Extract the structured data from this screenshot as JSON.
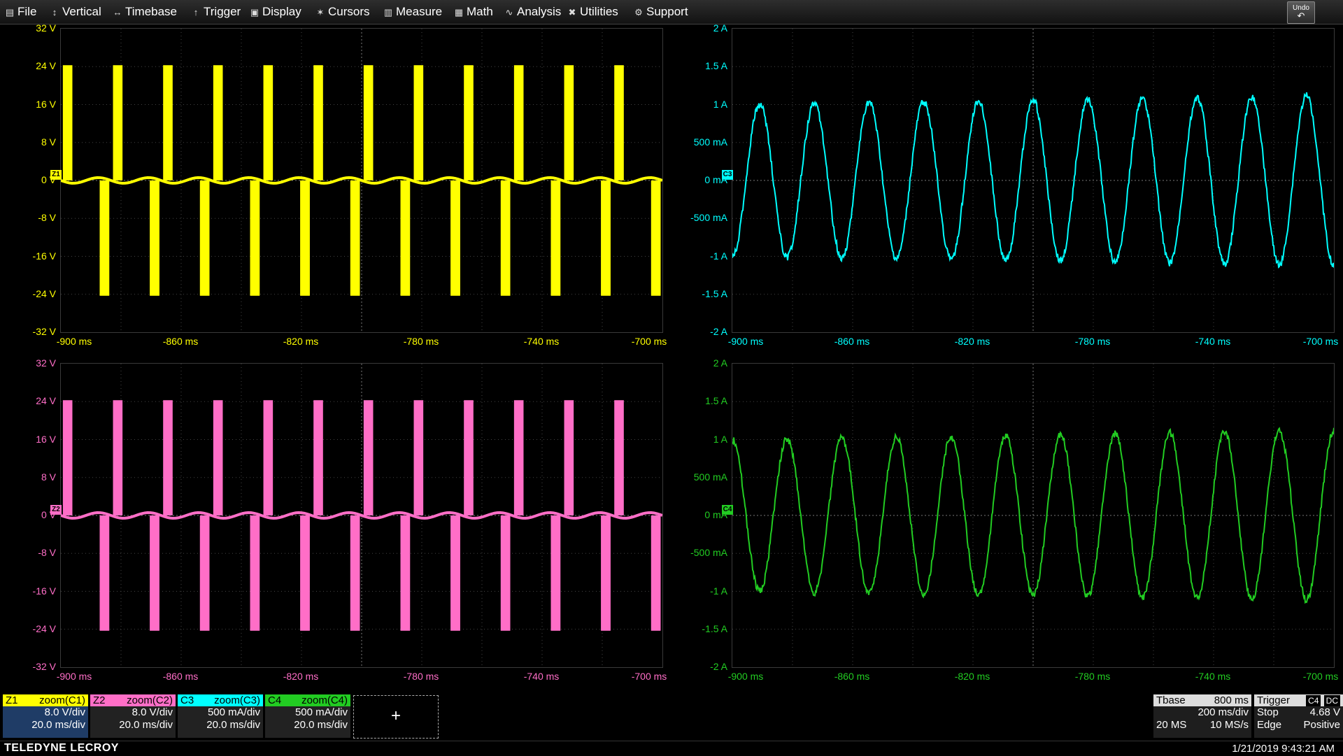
{
  "menu": [
    {
      "label": "File",
      "icon": "file-icon"
    },
    {
      "label": "Vertical",
      "icon": "vertical-icon"
    },
    {
      "label": "Timebase",
      "icon": "timebase-icon"
    },
    {
      "label": "Trigger",
      "icon": "trigger-icon"
    },
    {
      "label": "Display",
      "icon": "display-icon"
    },
    {
      "label": "Cursors",
      "icon": "cursors-icon"
    },
    {
      "label": "Measure",
      "icon": "measure-icon"
    },
    {
      "label": "Math",
      "icon": "math-icon"
    },
    {
      "label": "Analysis",
      "icon": "analysis-icon"
    },
    {
      "label": "Utilities",
      "icon": "utilities-icon"
    },
    {
      "label": "Support",
      "icon": "support-icon"
    }
  ],
  "undo_label": "Undo",
  "plots": [
    {
      "id": "Z1",
      "color": "#ffff00",
      "marker": "Z1",
      "kind": "pwm",
      "y_labels": [
        "32 V",
        "24 V",
        "16 V",
        "8 V",
        "0 V",
        "-8 V",
        "-16 V",
        "-24 V",
        "-32 V"
      ],
      "x_labels": [
        "-900 ms",
        "-860 ms",
        "-820 ms",
        "-780 ms",
        "-740 ms",
        "-700 ms"
      ]
    },
    {
      "id": "C3",
      "color": "#00ffff",
      "marker": "C3",
      "kind": "sine",
      "y_labels": [
        "2 A",
        "1.5 A",
        "1 A",
        "500 mA",
        "0 mA",
        "-500 mA",
        "-1 A",
        "-1.5 A",
        "-2 A"
      ],
      "x_labels": [
        "-900 ms",
        "-860 ms",
        "-820 ms",
        "-780 ms",
        "-740 ms",
        "-700 ms"
      ]
    },
    {
      "id": "Z2",
      "color": "#ff6ec7",
      "marker": "Z2",
      "kind": "pwm",
      "y_labels": [
        "32 V",
        "24 V",
        "16 V",
        "8 V",
        "0 V",
        "-8 V",
        "-16 V",
        "-24 V",
        "-32 V"
      ],
      "x_labels": [
        "-900 ms",
        "-860 ms",
        "-820 ms",
        "-780 ms",
        "-740 ms",
        "-700 ms"
      ]
    },
    {
      "id": "C4",
      "color": "#22cc22",
      "marker": "C4",
      "kind": "sine",
      "y_labels": [
        "2 A",
        "1.5 A",
        "1 A",
        "500 mA",
        "0 mA",
        "-500 mA",
        "-1 A",
        "-1.5 A",
        "-2 A"
      ],
      "x_labels": [
        "-900 ms",
        "-860 ms",
        "-820 ms",
        "-780 ms",
        "-740 ms",
        "-700 ms"
      ]
    }
  ],
  "descriptors": [
    {
      "tag": "Z1",
      "source": "zoom(C1)",
      "vdiv": "8.0 V/div",
      "tdiv": "20.0 ms/div",
      "color": "#ffff00",
      "body": "#1f3c66"
    },
    {
      "tag": "Z2",
      "source": "zoom(C2)",
      "vdiv": "8.0 V/div",
      "tdiv": "20.0 ms/div",
      "color": "#ff6ec7",
      "body": "#222222"
    },
    {
      "tag": "C3",
      "source": "zoom(C3)",
      "vdiv": "500 mA/div",
      "tdiv": "20.0 ms/div",
      "color": "#00ffff",
      "body": "#222222"
    },
    {
      "tag": "C4",
      "source": "zoom(C4)",
      "vdiv": "500 mA/div",
      "tdiv": "20.0 ms/div",
      "color": "#22cc22",
      "body": "#222222"
    }
  ],
  "add_label": "+",
  "timebase": {
    "title": "Tbase",
    "value": "800 ms",
    "rate": "200 ms/div",
    "samples": "20 MS",
    "srate": "10 MS/s"
  },
  "trigger": {
    "title": "Trigger",
    "source": "C4",
    "coupling": "DC",
    "mode": "Stop",
    "level": "4.68 V",
    "type": "Edge",
    "slope": "Positive"
  },
  "brand": "TELEDYNE LECROY",
  "datetime": "1/21/2019 9:43:21 AM"
}
